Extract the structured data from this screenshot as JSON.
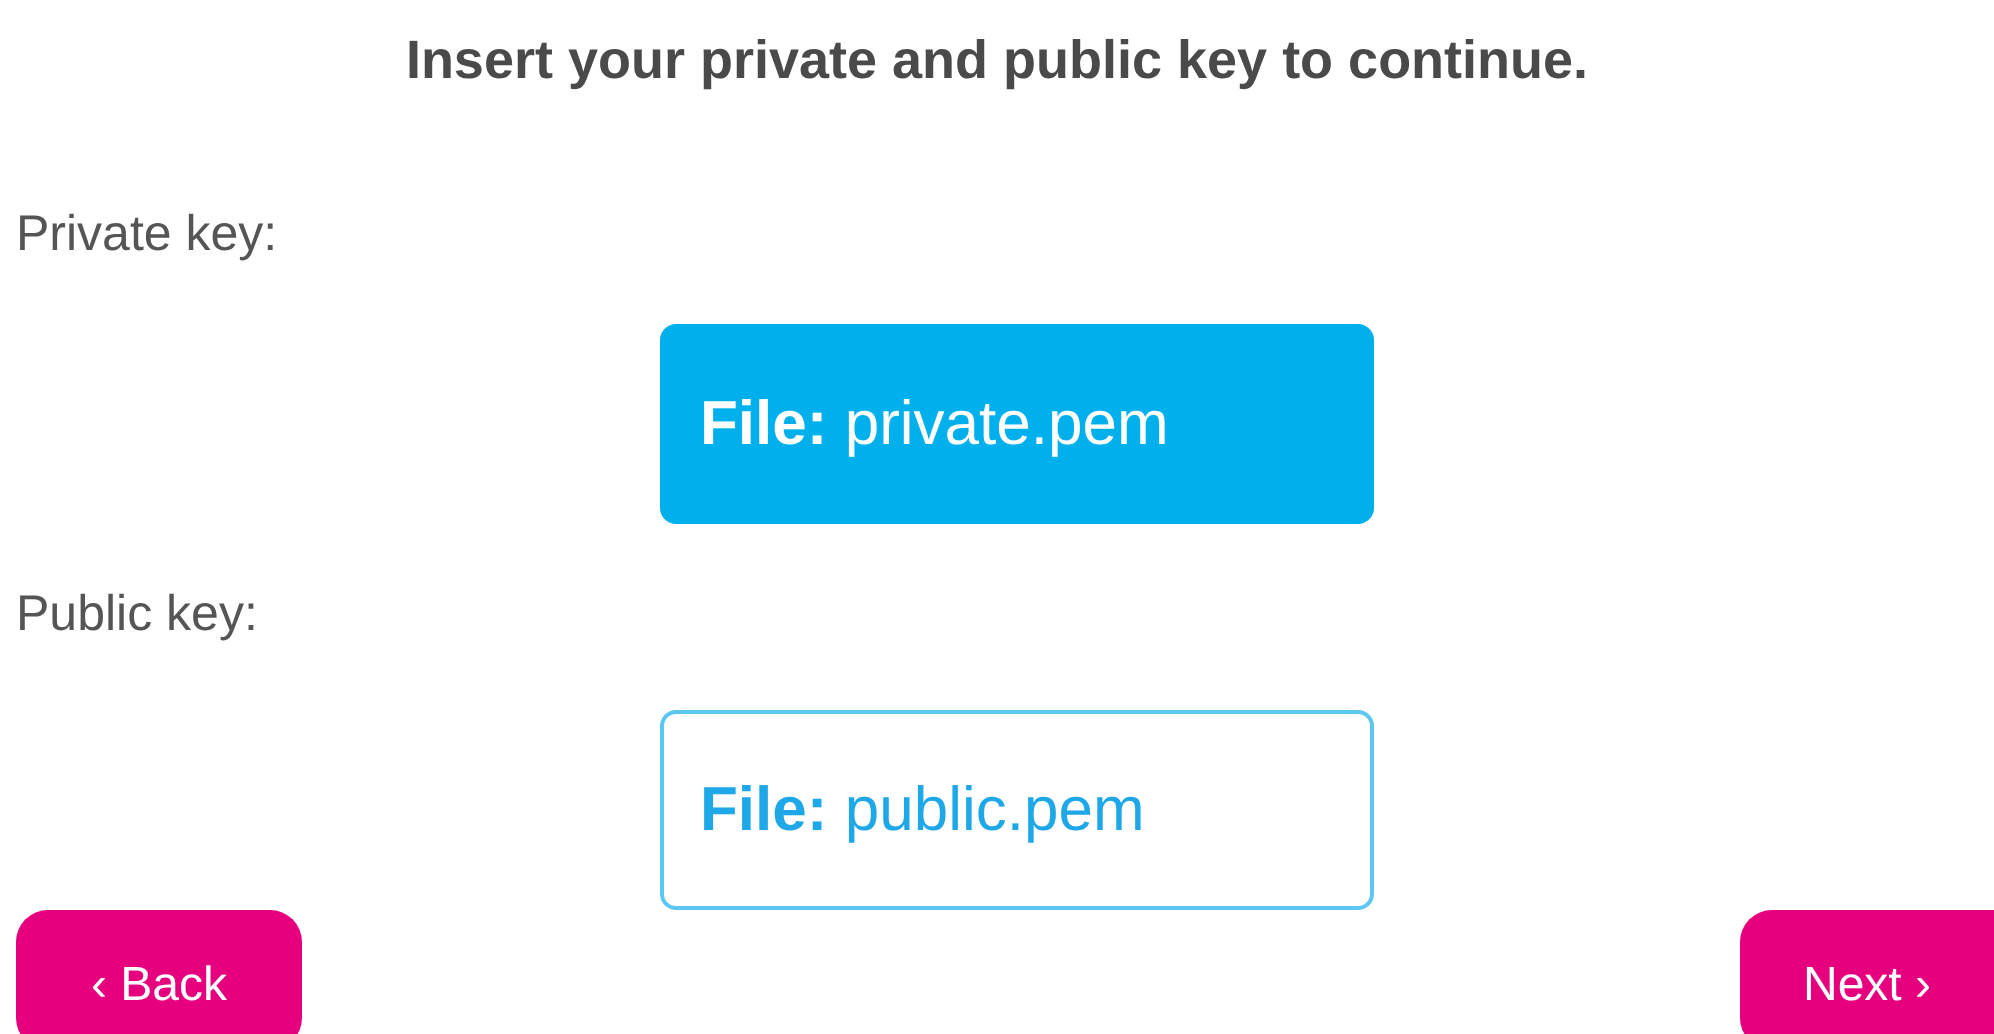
{
  "title": "Insert your private and public key to continue.",
  "keys": [
    {
      "label": "Private key:",
      "file": "**File:** private.pem",
      "selected": true
    },
    {
      "label": "Public key:",
      "file": "**File:** public.pem",
      "selected": false
    }
  ],
  "buttons": [
    {
      "label": "‹ Back"
    },
    {
      "label": "Next ›"
    }
  ]
}
